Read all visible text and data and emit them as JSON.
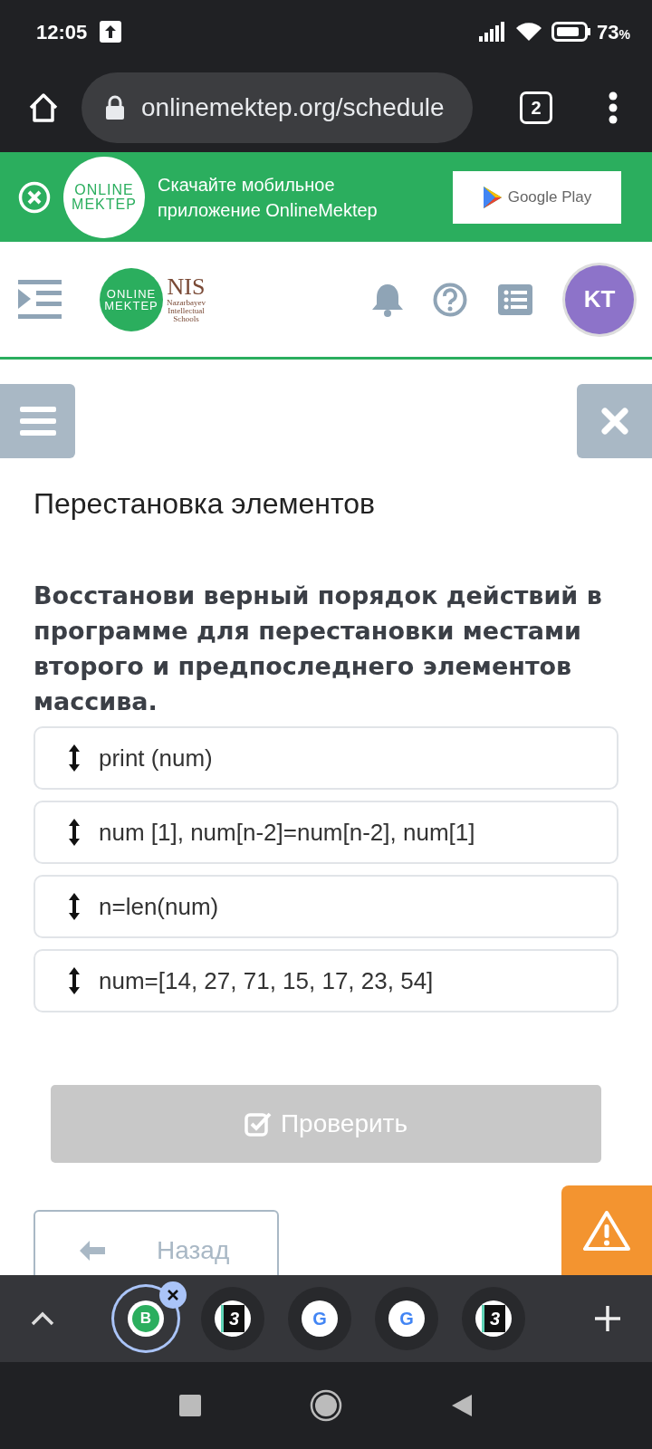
{
  "status_bar": {
    "time": "12:05",
    "battery": "73",
    "battery_unit": "%"
  },
  "browser": {
    "url": "onlinemektep.org/schedule",
    "tab_count": "2"
  },
  "banner": {
    "logo_lines": [
      "ONLINE",
      "MEKTEP"
    ],
    "text_lines": [
      "Скачайте мобильное",
      "приложение OnlineMektep"
    ],
    "store": "Google Play"
  },
  "header": {
    "logo_lines": [
      "ONLINE",
      "MEKTEP"
    ],
    "nis_title": "NIS",
    "nis_lines": [
      "Nazarbayev",
      "Intellectual",
      "Schools"
    ],
    "avatar": "KT"
  },
  "task": {
    "title": "Перестановка элементов",
    "question": "Восстанови верный порядок действий в программе для перестановки местами второго и предпоследнего элементов массива.",
    "items": [
      "print (num)",
      "num [1], num[n-2]=num[n-2], num[1]",
      "n=len(num)",
      "num=[14, 27, 71, 15, 17, 23, 54]"
    ],
    "check_button": {
      "label": "Проверить",
      "disabled": true
    },
    "back_button": "Назад"
  },
  "tab_strip": {
    "tabs": [
      {
        "favicon": "B",
        "kind": "b",
        "selected": true
      },
      {
        "favicon": "3",
        "kind": "three",
        "selected": false
      },
      {
        "favicon": "G",
        "kind": "g",
        "selected": false
      },
      {
        "favicon": "G",
        "kind": "g",
        "selected": false
      },
      {
        "favicon": "3",
        "kind": "three",
        "selected": false
      }
    ]
  }
}
